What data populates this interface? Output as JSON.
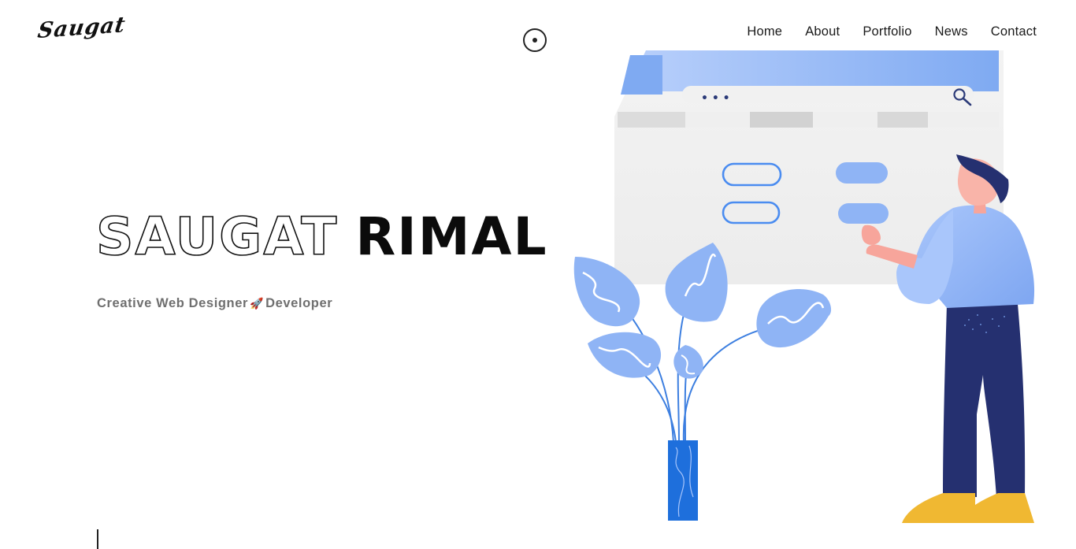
{
  "logo": {
    "text": "Saugat"
  },
  "nav": {
    "items": [
      {
        "label": "Home"
      },
      {
        "label": "About"
      },
      {
        "label": "Portfolio"
      },
      {
        "label": "News"
      },
      {
        "label": "Contact"
      }
    ]
  },
  "hero": {
    "first_name": "SAUGAT",
    "last_name": "RIMAL",
    "subtitle_part1": "Creative Web Designer",
    "subtitle_icon": "🚀",
    "subtitle_part2": "Developer"
  },
  "browser_mock": {
    "search_placeholder": "• • •"
  },
  "icons": {
    "theme_toggle": "circle-dot-icon",
    "search": "search-icon",
    "rocket": "rocket-icon"
  },
  "colors": {
    "accent_blue": "#8fb4f5",
    "dark_navy": "#253070",
    "vase_blue": "#1e6fdc",
    "shoe_yellow": "#f0b832",
    "text_gray": "#6f6f6f"
  }
}
